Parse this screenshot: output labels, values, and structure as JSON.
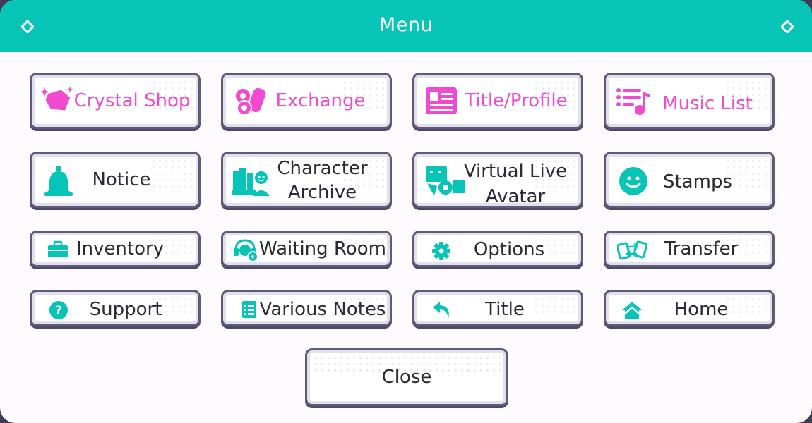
{
  "header": {
    "title": "Menu"
  },
  "colors": {
    "accent": "#07c5b6",
    "pink": "#f04ad0",
    "border": "#5d5b79"
  },
  "buttons": {
    "crystal_shop": {
      "label": "Crystal Shop",
      "icon": "crystal-icon"
    },
    "exchange": {
      "label": "Exchange",
      "icon": "exchange-icon"
    },
    "title_profile": {
      "label": "Title/Profile",
      "icon": "profile-card-icon"
    },
    "music_list": {
      "label": "Music List",
      "icon": "music-list-icon"
    },
    "notice": {
      "label": "Notice",
      "icon": "bell-icon"
    },
    "character_archive": {
      "label_line1": "Character",
      "label_line2": "Archive",
      "icon": "archive-icon"
    },
    "virtual_live_avatar": {
      "label_line1": "Virtual Live",
      "label_line2": "Avatar",
      "icon": "virtual-live-icon"
    },
    "stamps": {
      "label": "Stamps",
      "icon": "smiley-icon"
    },
    "inventory": {
      "label": "Inventory",
      "icon": "briefcase-icon"
    },
    "waiting_room": {
      "label": "Waiting Room",
      "icon": "headset-icon"
    },
    "options": {
      "label": "Options",
      "icon": "gear-icon"
    },
    "transfer": {
      "label": "Transfer",
      "icon": "transfer-icon"
    },
    "support": {
      "label": "Support",
      "icon": "question-icon"
    },
    "various_notes": {
      "label": "Various Notes",
      "icon": "notes-icon"
    },
    "title": {
      "label": "Title",
      "icon": "back-arrow-icon"
    },
    "home": {
      "label": "Home",
      "icon": "home-icon"
    }
  },
  "close": {
    "label": "Close"
  }
}
